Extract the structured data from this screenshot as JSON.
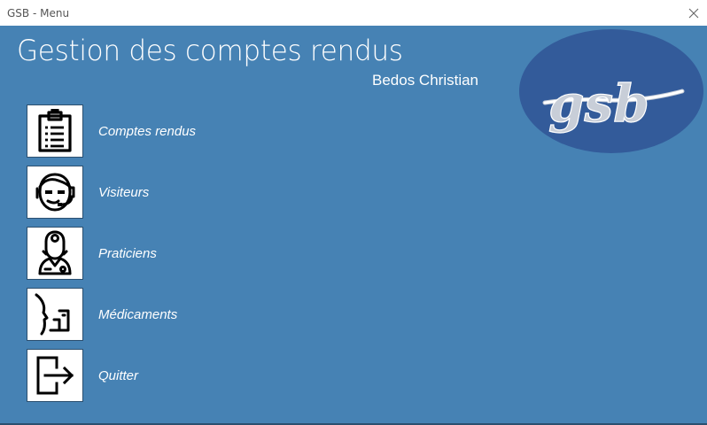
{
  "window": {
    "title": "GSB - Menu",
    "close_icon": "close-icon"
  },
  "header": {
    "heading": "Gestion des comptes rendus",
    "user_name": "Bedos Christian",
    "logo_text": "gsb"
  },
  "menu": {
    "items": [
      {
        "label": "Comptes rendus",
        "icon": "clipboard-icon"
      },
      {
        "label": "Visiteurs",
        "icon": "headset-person-icon"
      },
      {
        "label": "Praticiens",
        "icon": "doctor-icon"
      },
      {
        "label": "Médicaments",
        "icon": "inhaler-icon"
      },
      {
        "label": "Quitter",
        "icon": "exit-icon"
      }
    ]
  },
  "colors": {
    "background": "#4682b4",
    "logo_ellipse": "#335b9a",
    "text": "#ffffff"
  }
}
